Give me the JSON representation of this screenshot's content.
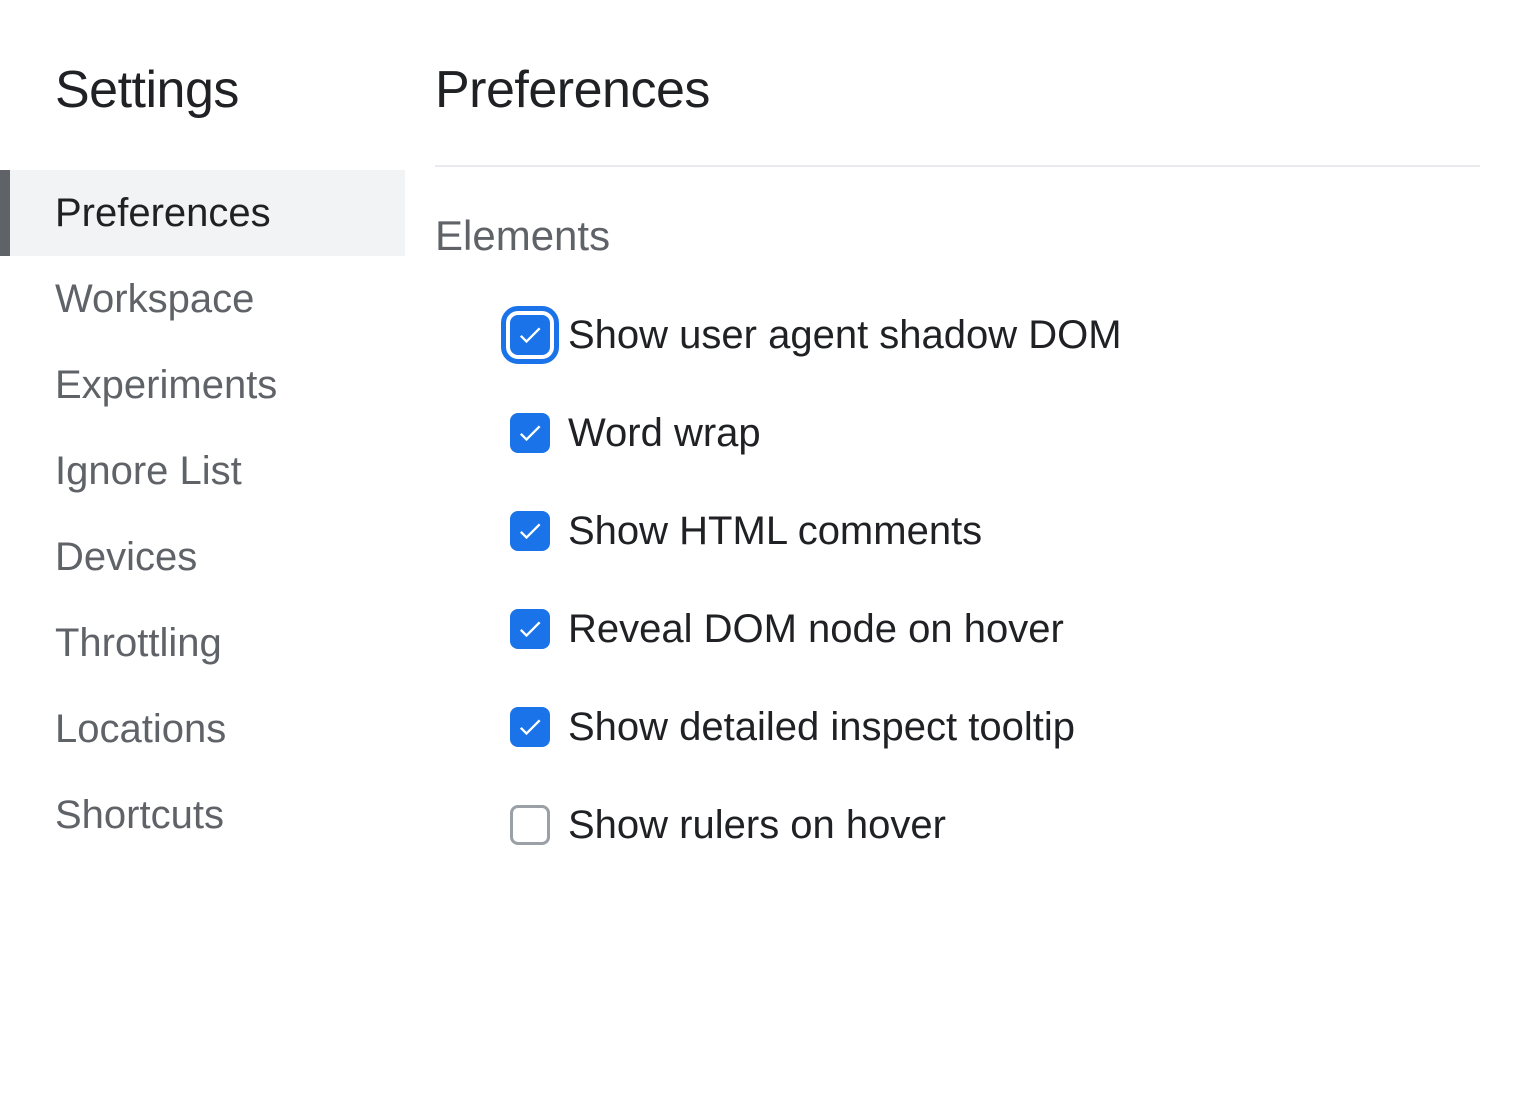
{
  "sidebar": {
    "title": "Settings",
    "items": [
      {
        "label": "Preferences",
        "active": true
      },
      {
        "label": "Workspace",
        "active": false
      },
      {
        "label": "Experiments",
        "active": false
      },
      {
        "label": "Ignore List",
        "active": false
      },
      {
        "label": "Devices",
        "active": false
      },
      {
        "label": "Throttling",
        "active": false
      },
      {
        "label": "Locations",
        "active": false
      },
      {
        "label": "Shortcuts",
        "active": false
      }
    ]
  },
  "main": {
    "title": "Preferences",
    "section_title": "Elements",
    "options": [
      {
        "label": "Show user agent shadow DOM",
        "checked": true,
        "focused": true
      },
      {
        "label": "Word wrap",
        "checked": true,
        "focused": false
      },
      {
        "label": "Show HTML comments",
        "checked": true,
        "focused": false
      },
      {
        "label": "Reveal DOM node on hover",
        "checked": true,
        "focused": false
      },
      {
        "label": "Show detailed inspect tooltip",
        "checked": true,
        "focused": false
      },
      {
        "label": "Show rulers on hover",
        "checked": false,
        "focused": false
      }
    ]
  }
}
